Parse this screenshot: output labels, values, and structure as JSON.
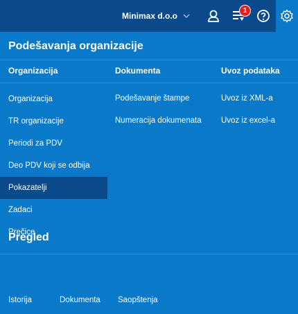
{
  "topbar": {
    "company": "Minimax d.o.o",
    "notifications_count": "1",
    "icons": [
      "user-icon",
      "messages-icon",
      "help-icon",
      "settings-icon"
    ]
  },
  "panel": {
    "title": "Podešavanja organizacije",
    "columns": [
      {
        "header": "Organizacija",
        "items": [
          "Organizacija",
          "TR organizacije",
          "Periodi za PDV",
          "Deo PDV koji se odbija",
          "Pokazatelji",
          "Zadaci",
          "Prečice"
        ],
        "selected": "Pokazatelji"
      },
      {
        "header": "Dokumenta",
        "items": [
          "Podešavanje štampe",
          "Numeracija dokumenata"
        ]
      },
      {
        "header": "Uvoz podataka",
        "items": [
          "Uvoz iz XML-a",
          "Uvoz iz excel-a"
        ]
      }
    ]
  },
  "overview": {
    "title": "Pregled",
    "links": [
      "Istorija",
      "Dokumenta",
      "Saopštenja"
    ]
  },
  "colors": {
    "panel_bg": "#0b79c9",
    "topbar_bg": "#0a4a8a",
    "selected_bg": "#0a4a8a",
    "badge": "#e02020"
  }
}
